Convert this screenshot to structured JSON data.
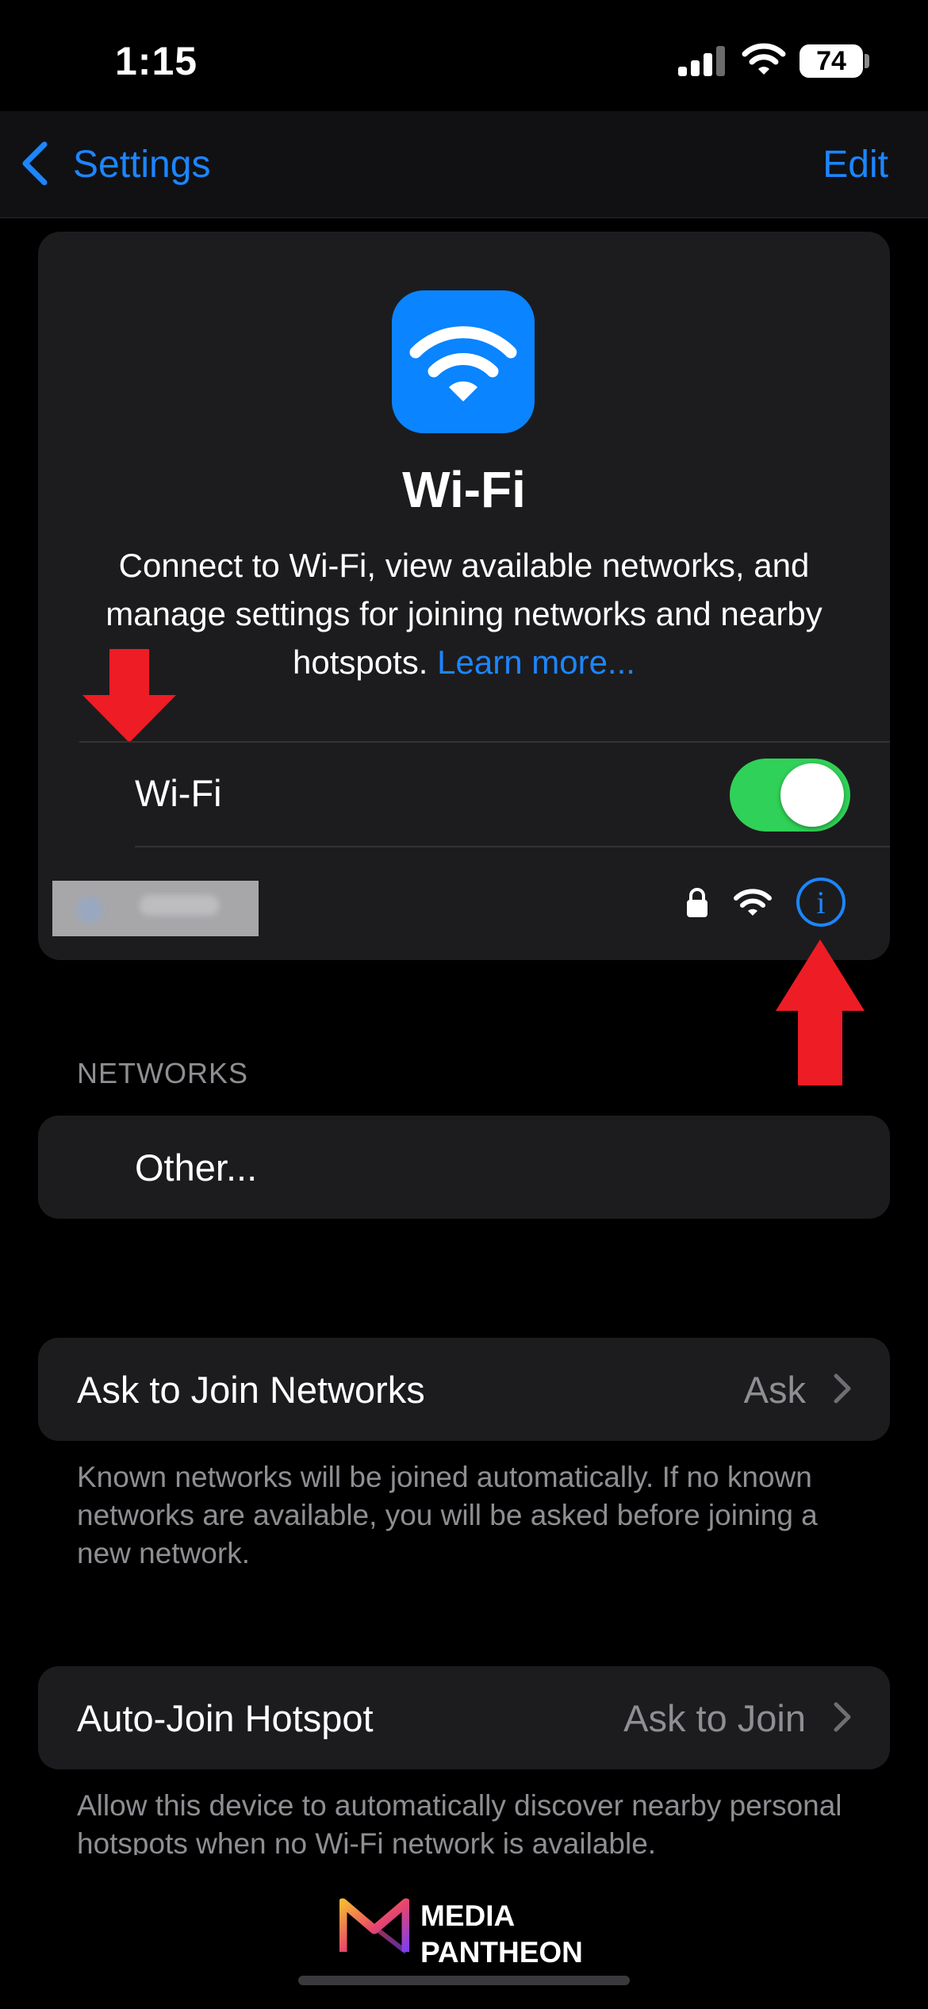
{
  "status_bar": {
    "time": "1:15",
    "battery": "74"
  },
  "nav": {
    "back_label": "Settings",
    "edit_label": "Edit"
  },
  "header": {
    "title": "Wi-Fi",
    "description": "Connect to Wi-Fi, view available networks, and manage settings for joining networks and nearby hotspots.",
    "learn_more": "Learn more..."
  },
  "wifi_toggle": {
    "label": "Wi-Fi",
    "on": true
  },
  "connected_network": {
    "name_visible": false
  },
  "networks": {
    "header": "NETWORKS",
    "other_label": "Other..."
  },
  "ask_to_join": {
    "label": "Ask to Join Networks",
    "value": "Ask",
    "footer": "Known networks will be joined automatically. If no known networks are available, you will be asked before joining a new network."
  },
  "auto_join_hotspot": {
    "label": "Auto-Join Hotspot",
    "value": "Ask to Join",
    "footer": "Allow this device to automatically discover nearby personal hotspots when no Wi-Fi network is available."
  },
  "watermark": {
    "line1": "MEDIA",
    "line2": "PANTHEON"
  },
  "colors": {
    "accent": "#1c86ff",
    "toggle_on": "#30d158",
    "annotation_arrow": "#ee1c25",
    "card": "#1c1c1e"
  },
  "icons": [
    "chevron-left-icon",
    "wifi-icon",
    "lock-icon",
    "info-icon",
    "chevron-right-icon",
    "arrow-down-icon",
    "arrow-up-icon"
  ]
}
